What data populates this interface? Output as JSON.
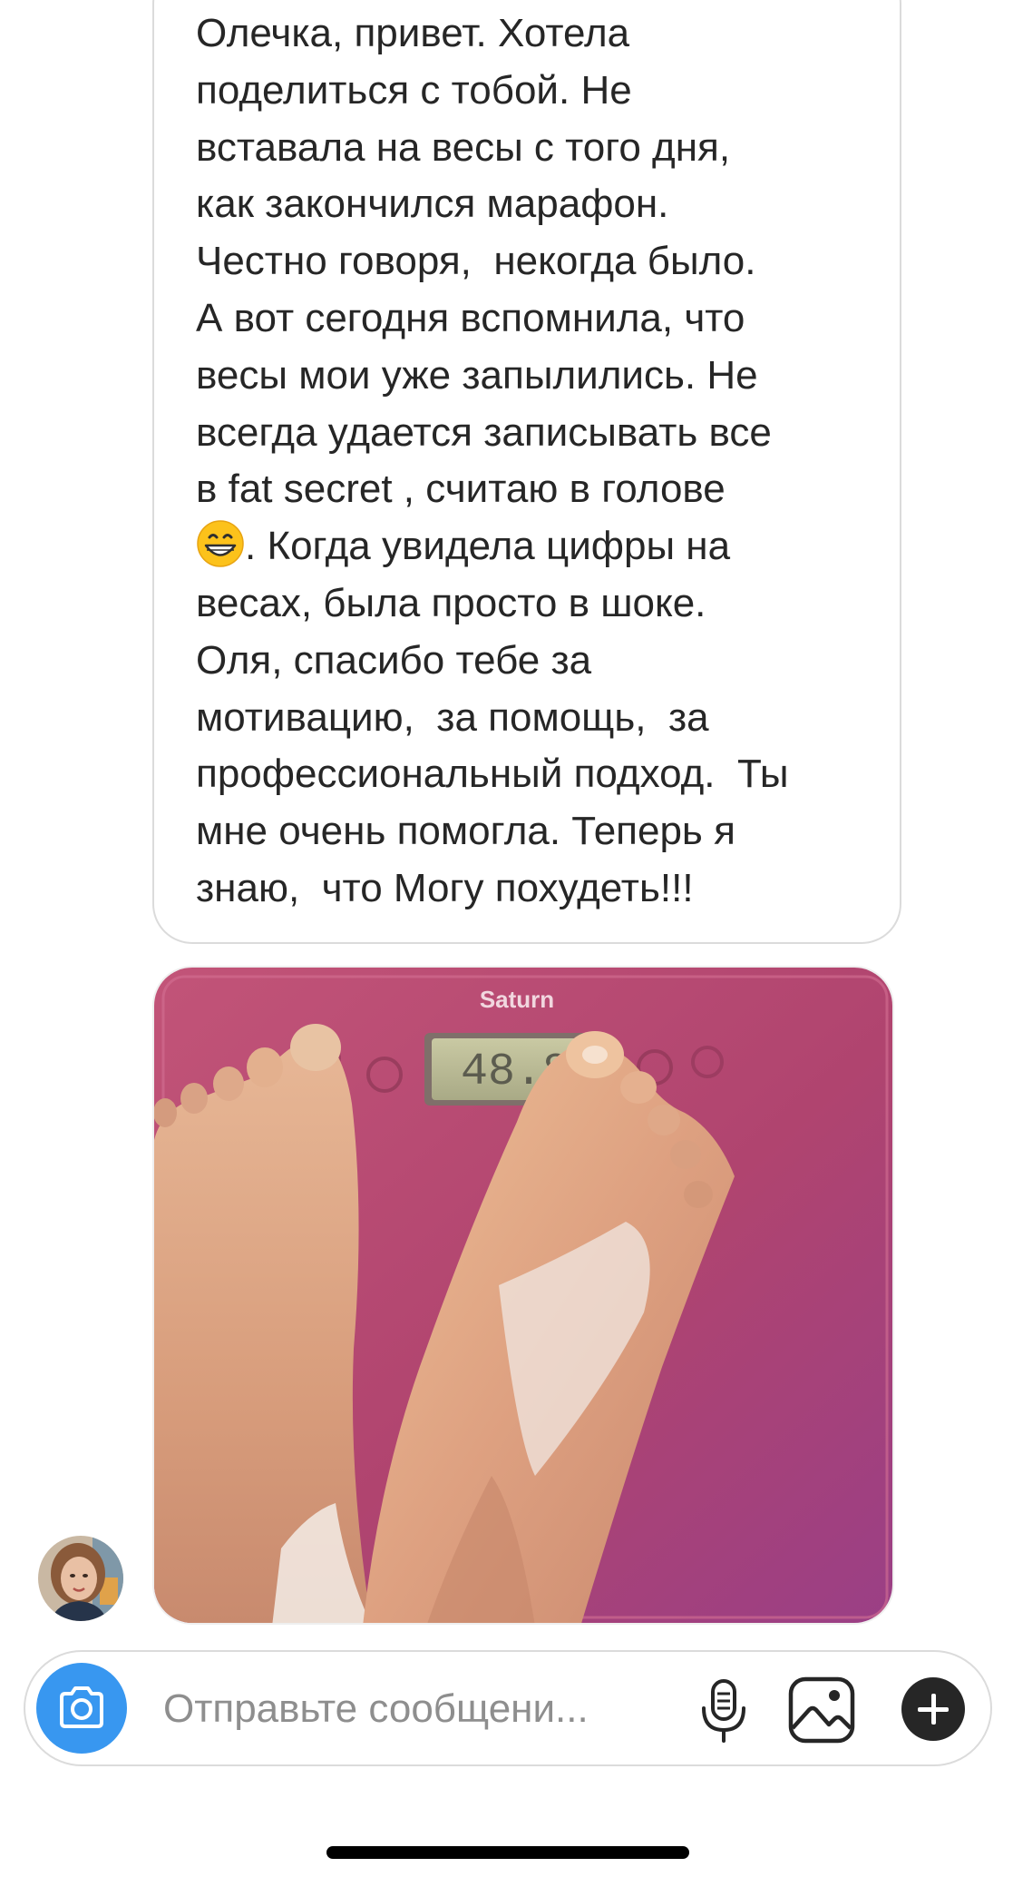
{
  "message": {
    "text_before_emoji": "Олечка, привет. Хотела\nподелиться с тобой. Не\nвставала на весы с того дня,\nкак закончился марафон.\nЧестно говоря,  некогда было.\nА вот сегодня вспомнила, что\nвесы мои уже запылились. Не\nвсегда удается записывать все\nв fat secret , считаю в голове\n",
    "emoji": "grinning-face-with-smiling-eyes",
    "text_after_emoji": ". Когда увидела цифры на\nвесах, была просто в шоке.\nОля, спасибо тебе за\nмотивацию,  за помощь,  за\nпрофессиональный подход.  Ты\nмне очень помогла. Теперь я\nзнаю,  что Могу похудеть!!!"
  },
  "photo": {
    "scale_brand": "Saturn",
    "scale_display": "48.8",
    "scale_color": "#b64a74"
  },
  "composer": {
    "placeholder": "Отправьте сообщени...",
    "icons": [
      "camera-icon",
      "microphone-icon",
      "gallery-icon",
      "plus-icon"
    ]
  },
  "colors": {
    "accent": "#3897f0",
    "text": "#262626",
    "border": "#dbdbdb"
  }
}
